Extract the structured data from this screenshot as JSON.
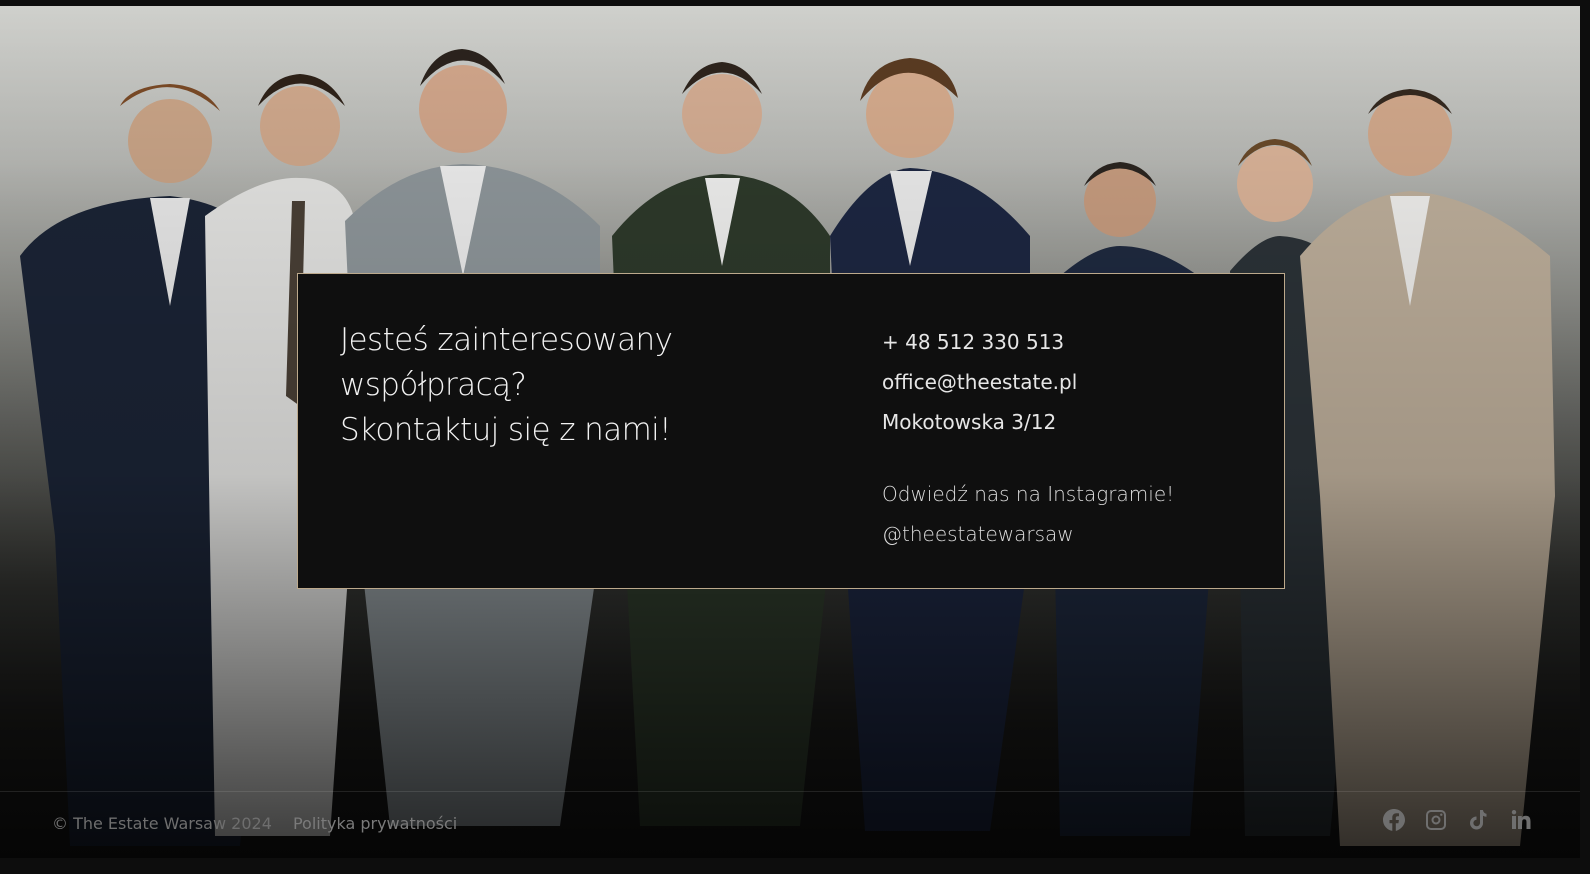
{
  "contact": {
    "headline_line1": "Jesteś zainteresowany",
    "headline_line2": "współpracą?",
    "headline_line3": "Skontaktuj się z nami!",
    "phone": "+ 48 512 330 513",
    "email": "office@theestate.pl",
    "address": "Mokotowska 3/12",
    "instagram_label": "Odwiedź nas na Instagramie!",
    "instagram_handle": "@theestatewarsaw"
  },
  "footer": {
    "copyright": "© The Estate Warsaw 2024",
    "privacy_link": "Polityka prywatności",
    "socials": [
      "facebook-icon",
      "instagram-icon",
      "tiktok-icon",
      "linkedin-icon"
    ]
  },
  "colors": {
    "card_background": "#0f0f0f",
    "card_border": "#bca98c",
    "text": "#f2f2f2",
    "footer_text": "#6e6e6e"
  }
}
